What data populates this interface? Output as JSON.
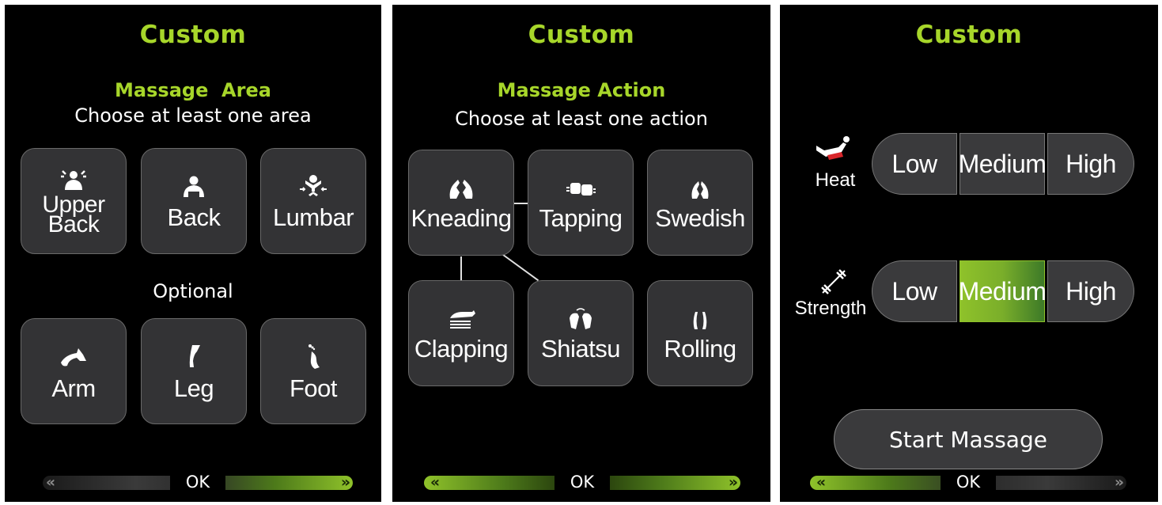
{
  "screen1": {
    "title": "Custom",
    "subtitle": "Massage  Area",
    "hint": "Choose at least one area",
    "optional": "Optional",
    "areas": [
      {
        "label": "Upper\nBack",
        "icon": "upper-back-icon"
      },
      {
        "label": "Back",
        "icon": "back-icon"
      },
      {
        "label": "Lumbar",
        "icon": "lumbar-icon"
      }
    ],
    "optional_areas": [
      {
        "label": "Arm",
        "icon": "arm-icon"
      },
      {
        "label": "Leg",
        "icon": "leg-icon"
      },
      {
        "label": "Foot",
        "icon": "foot-icon"
      }
    ],
    "ok": "OK"
  },
  "screen2": {
    "title": "Custom",
    "subtitle": "Massage Action",
    "hint": "Choose at least one action",
    "actions": [
      {
        "label": "Kneading",
        "icon": "kneading-icon"
      },
      {
        "label": "Tapping",
        "icon": "tapping-icon"
      },
      {
        "label": "Swedish",
        "icon": "swedish-icon"
      },
      {
        "label": "Clapping",
        "icon": "clapping-icon"
      },
      {
        "label": "Shiatsu",
        "icon": "shiatsu-icon"
      },
      {
        "label": "Rolling",
        "icon": "rolling-icon"
      }
    ],
    "ok": "OK"
  },
  "screen3": {
    "title": "Custom",
    "heat": {
      "label": "Heat",
      "icon": "heat-icon",
      "options": [
        "Low",
        "Medium",
        "High"
      ],
      "selected": null
    },
    "strength": {
      "label": "Strength",
      "icon": "strength-icon",
      "options": [
        "Low",
        "Medium",
        "High"
      ],
      "selected": "Medium"
    },
    "start": "Start Massage",
    "ok": "OK"
  },
  "colors": {
    "accent": "#a7d62a",
    "tile_bg": "#333335",
    "selected_gradient_start": "#8fc22a",
    "selected_gradient_end": "#3d7a28",
    "heat_red": "#d8262b"
  }
}
